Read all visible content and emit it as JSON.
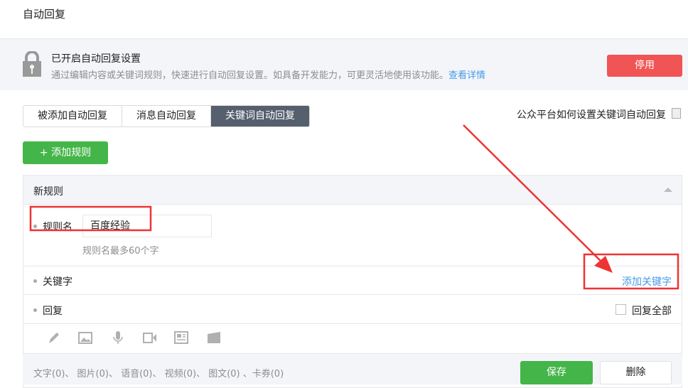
{
  "page_title": "自动回复",
  "banner": {
    "title": "已开启自动回复设置",
    "desc": "通过编辑内容或关键词规则，快速进行自动回复设置。如具备开发能力，可更灵活地使用该功能。",
    "link": "查看详情",
    "stop_button": "停用"
  },
  "tabs": [
    {
      "label": "被添加自动回复"
    },
    {
      "label": "消息自动回复"
    },
    {
      "label": "关键词自动回复",
      "active": true
    }
  ],
  "help_link": "公众平台如何设置关键词自动回复",
  "add_rule_button": "添加规则",
  "rule": {
    "header": "新规则",
    "name_label": "规则名",
    "name_value": "百度经验",
    "name_hint": "规则名最多60个字",
    "keyword_label": "关键字",
    "add_keyword": "添加关键字",
    "reply_label": "回复",
    "reply_all": "回复全部",
    "toolbar_icons": [
      "pencil-icon",
      "image-icon",
      "microphone-icon",
      "video-icon",
      "news-icon",
      "card-icon"
    ],
    "counts": "文字(0)、 图片(0)、 语音(0)、 视频(0)、 图文(0) 、卡券(0)",
    "save": "保存",
    "delete": "删除"
  },
  "colors": {
    "accent_green": "#44b549",
    "danger": "#f15454",
    "link": "#459ae9",
    "annotation": "#ee3333"
  }
}
